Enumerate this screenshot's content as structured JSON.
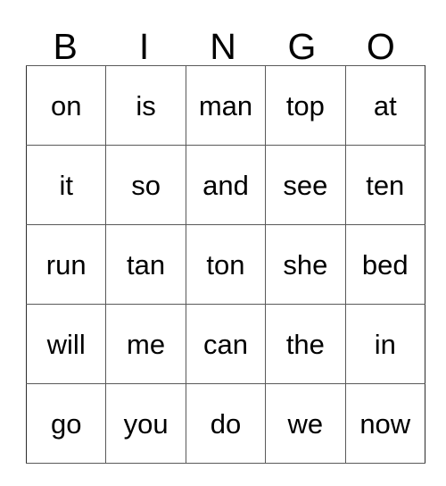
{
  "card": {
    "title": "BINGO",
    "columns": [
      {
        "letter": "B"
      },
      {
        "letter": "I"
      },
      {
        "letter": "N"
      },
      {
        "letter": "G"
      },
      {
        "letter": "O"
      }
    ],
    "rows": [
      {
        "cells": [
          "on",
          "is",
          "man",
          "top",
          "at"
        ]
      },
      {
        "cells": [
          "it",
          "so",
          "and",
          "see",
          "ten"
        ]
      },
      {
        "cells": [
          "run",
          "tan",
          "ton",
          "she",
          "bed"
        ]
      },
      {
        "cells": [
          "will",
          "me",
          "can",
          "the",
          "in"
        ]
      },
      {
        "cells": [
          "go",
          "you",
          "do",
          "we",
          "now"
        ]
      }
    ],
    "colors": {
      "text": "#000000",
      "grid_line": "#595959",
      "background": "#ffffff"
    }
  }
}
